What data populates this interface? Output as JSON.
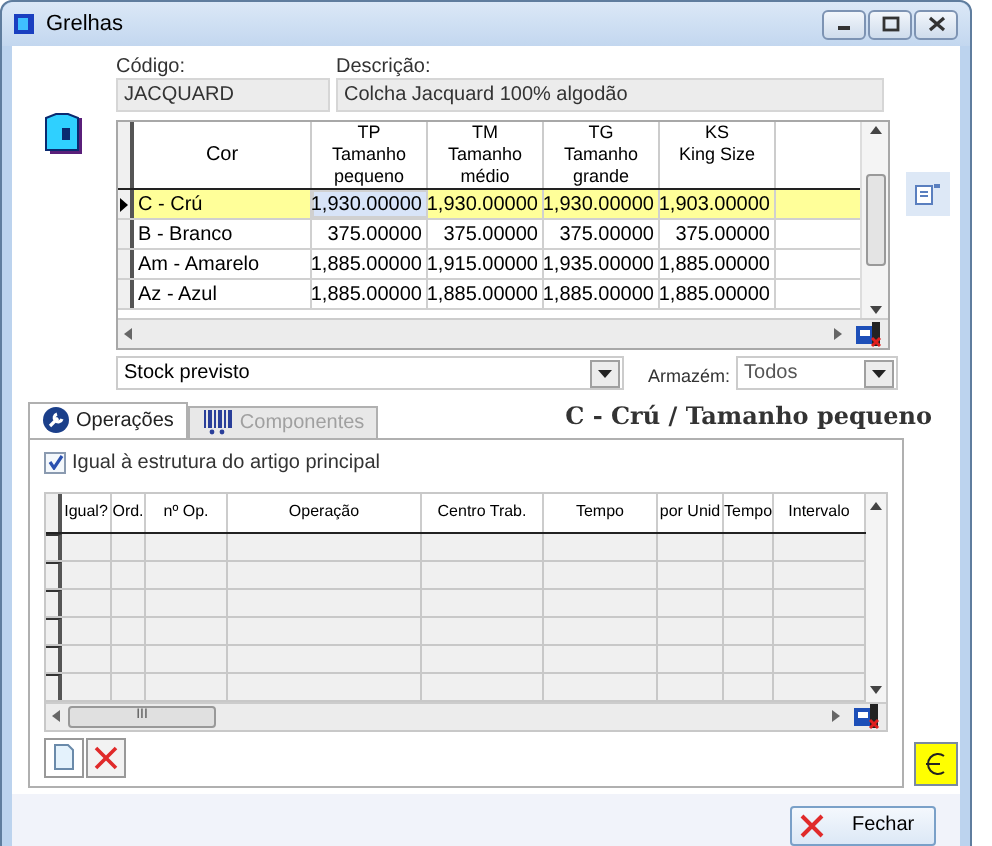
{
  "window": {
    "title": "Grelhas"
  },
  "header_fields": [
    {
      "label": "Código:",
      "value": "JACQUARD"
    },
    {
      "label": "Descrição:",
      "value": "Colcha Jacquard 100% algodão"
    }
  ],
  "grid": {
    "row_header": "Cor",
    "columns": [
      {
        "lines": [
          "TP",
          "Tamanho",
          "pequeno"
        ]
      },
      {
        "lines": [
          "TM",
          "Tamanho",
          "médio"
        ]
      },
      {
        "lines": [
          "TG",
          "Tamanho",
          "grande"
        ]
      },
      {
        "lines": [
          "KS",
          "King Size"
        ]
      }
    ],
    "rows": [
      {
        "label": "C - Crú",
        "selected": true,
        "values": [
          "1,930.00000",
          "1,930.00000",
          "1,930.00000",
          "1,903.00000"
        ]
      },
      {
        "label": "B - Branco",
        "selected": false,
        "values": [
          "375.00000",
          "375.00000",
          "375.00000",
          "375.00000"
        ]
      },
      {
        "label": "Am - Amarelo",
        "selected": false,
        "values": [
          "1,885.00000",
          "1,915.00000",
          "1,935.00000",
          "1,885.00000"
        ]
      },
      {
        "label": "Az - Azul",
        "selected": false,
        "values": [
          "1,885.00000",
          "1,885.00000",
          "1,885.00000",
          "1,885.00000"
        ]
      }
    ]
  },
  "stock_select": {
    "value": "Stock previsto"
  },
  "warehouse": {
    "label": "Armazém:",
    "value": "Todos"
  },
  "tabs": [
    {
      "label": "Operações",
      "kind": "operations",
      "selected": true,
      "disabled": false
    },
    {
      "label": "Componentes",
      "kind": "components",
      "selected": false,
      "disabled": true
    }
  ],
  "detail_title": "C - Crú / Tamanho pequeno",
  "same_structure": {
    "label": "Igual à estrutura do artigo principal",
    "checked": true
  },
  "operations_table": {
    "columns": [
      "Igual?",
      "Ord.",
      "nº Op.",
      "Operação",
      "Centro Trab.",
      "Tempo",
      "por Unid",
      "Tempo",
      "Intervalo"
    ],
    "scroll_label": "III"
  },
  "close_button": {
    "label": "Fechar"
  }
}
